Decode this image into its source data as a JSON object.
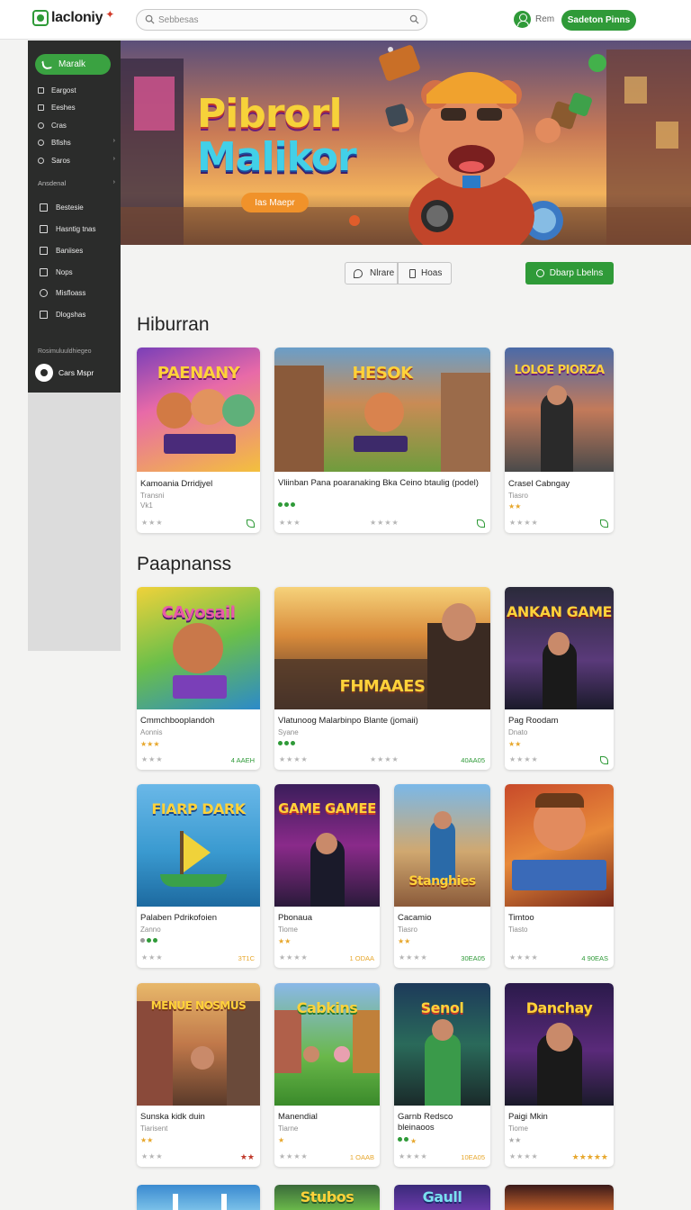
{
  "header": {
    "logo_text": "lacloniy",
    "search_placeholder": "Sebbesas",
    "user_label": "Rem",
    "cta_label": "Sadeton Pinns"
  },
  "sidebar": {
    "pill_label": "Maralk",
    "items": [
      {
        "label": "Eargost",
        "icon": "home-icon"
      },
      {
        "label": "Eeshes",
        "icon": "edit-icon"
      },
      {
        "label": "Cras",
        "icon": "tag-icon"
      },
      {
        "label": "Bfishs",
        "icon": "settings-icon"
      },
      {
        "label": "Saros",
        "icon": "settings-icon"
      }
    ],
    "section_head": "Ansdenal",
    "items2": [
      {
        "label": "Bestesie",
        "icon": "chart-icon"
      },
      {
        "label": "Hasntig tnas",
        "icon": "store-icon"
      },
      {
        "label": "Baniises",
        "icon": "grid-icon"
      },
      {
        "label": "Nops",
        "icon": "image-icon"
      },
      {
        "label": "Misfloass",
        "icon": "chat-icon"
      },
      {
        "label": "Dlogshas",
        "icon": "flag-icon"
      }
    ],
    "footer_label": "Rosimuluuldhiegeo",
    "account_label": "Cars Mspr"
  },
  "hero": {
    "title_line1": "Pibrorl",
    "title_line2": "Malikor",
    "button_label": "Ias Maepr"
  },
  "filters": {
    "left_label": "Nlrare",
    "right_label": "Hoas",
    "green_label": "Dbarp Lbelns"
  },
  "sections": [
    {
      "title": "Hiburran",
      "cards": [
        {
          "thumb_text": "PAENANY",
          "title": "Kamoania Drridjyel",
          "sub": "Transni",
          "meta": "Vk1"
        },
        {
          "thumb_text": "HESOK",
          "title": "Vliinban Pana poaranaking Bka Ceino btaulig (podel)",
          "sub": ""
        },
        {
          "thumb_text": "LOLOE PIORZA",
          "title": "Crasel Cabngay",
          "sub": "Tiasro"
        }
      ]
    },
    {
      "title": "Paapnanss",
      "cards": [
        {
          "thumb_text": "CAyosail",
          "title": "Cmmchbooplandoh",
          "sub": "Aonnis",
          "plays": "4 AAEH"
        },
        {
          "thumb_text": "FHMAAES",
          "title": "Vlatunoog Malarbinpo Blante (jomaii)",
          "sub": "Syane",
          "plays": "40AA05"
        },
        {
          "thumb_text": "ANKAN GAME",
          "title": "Pag Roodam",
          "sub": "Dnato"
        }
      ]
    },
    {
      "cards": [
        {
          "thumb_text": "FIARP DARK",
          "title": "Palaben Pdrikofoien",
          "sub": "Zanno",
          "plays": "3T1C"
        },
        {
          "thumb_text": "GAME GAMEE",
          "title": "Pbonaua",
          "sub": "Tiome",
          "plays": "1 ODAA"
        },
        {
          "thumb_text": "Stanghies",
          "title": "Cacamio",
          "sub": "Tiasro",
          "plays": "30EA05"
        },
        {
          "thumb_text": "",
          "title": "Timtoo",
          "sub": "Tiasto",
          "plays": "4 90EAS"
        }
      ]
    },
    {
      "cards": [
        {
          "thumb_text": "MENUE NOSMUS",
          "title": "Sunska kidk duin",
          "sub": "Tiarisent"
        },
        {
          "thumb_text": "Cabkins",
          "title": "Manendial",
          "sub": "Tiarne",
          "plays": "1 OAAB"
        },
        {
          "thumb_text": "Senol",
          "title": "Garnb Redsco bleinaoos",
          "sub": "",
          "plays": "10EA05"
        },
        {
          "thumb_text": "Danchay",
          "title": "Paigi Mkin",
          "sub": "Tiome"
        }
      ]
    },
    {
      "cards": [
        {
          "thumb_text": ""
        },
        {
          "thumb_text": "Stubos"
        },
        {
          "thumb_text": "Gaull"
        },
        {
          "thumb_text": ""
        }
      ]
    }
  ],
  "colors": {
    "accent": "#2f9a38",
    "sidebar": "#2b2c2b",
    "hero_button": "#f0922a"
  }
}
